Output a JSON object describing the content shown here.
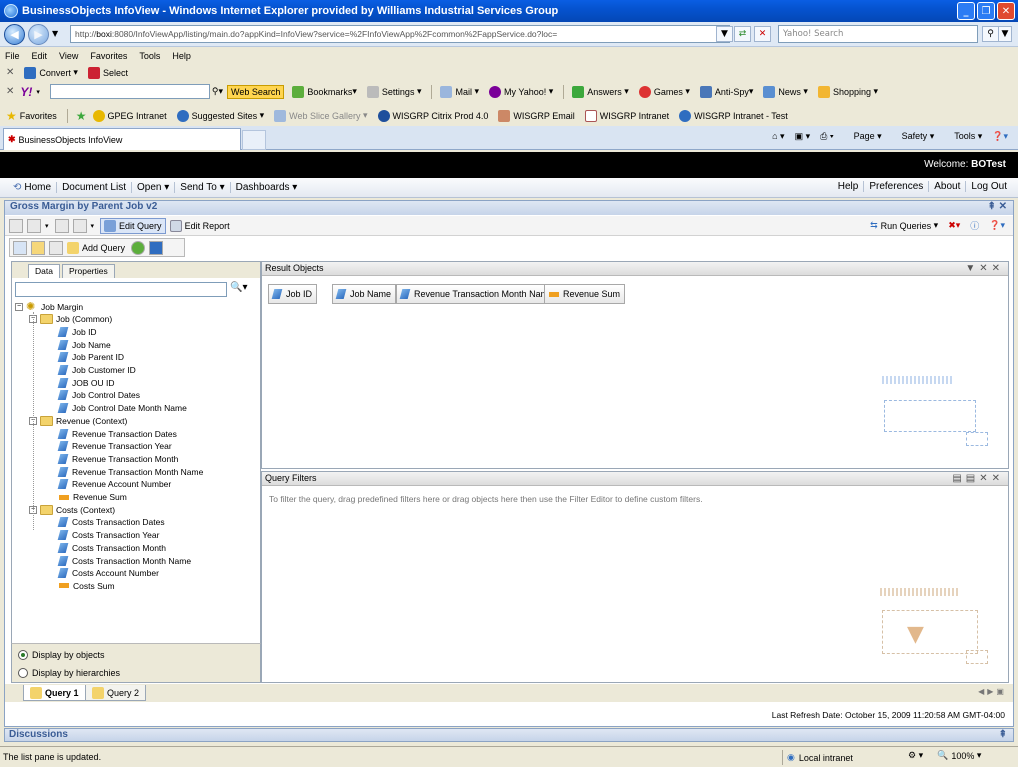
{
  "window": {
    "title": "BusinessObjects InfoView - Windows Internet Explorer provided by Williams Industrial Services Group",
    "buttons": [
      "_",
      "❐",
      "✕"
    ]
  },
  "address": {
    "url_prefix": "http://",
    "url_host": "boxi",
    "url_rest": ":8080/InfoViewApp/listing/main.do?appKind=InfoView?service=%2FInfoViewApp%2Fcommon%2FappService.do?loc=",
    "search_placeholder": "Yahoo! Search"
  },
  "menu": [
    "File",
    "Edit",
    "View",
    "Favorites",
    "Tools",
    "Help"
  ],
  "convert_bar": {
    "convert": "Convert",
    "select": "Select"
  },
  "yahoo_bar": {
    "logo": "Y!",
    "web_search": "Web Search",
    "items": [
      "Bookmarks",
      "Settings",
      "Mail",
      "My Yahoo!",
      "Answers",
      "Games",
      "Anti-Spy",
      "News",
      "Shopping"
    ]
  },
  "favorites_bar": {
    "favorites": "Favorites",
    "links": [
      "GPEG Intranet",
      "Suggested Sites",
      "Web Slice Gallery",
      "WISGRP Citrix Prod 4.0",
      "WISGRP Email",
      "WISGRP Intranet",
      "WISGRP Intranet - Test"
    ]
  },
  "ie_tab": {
    "title": "BusinessObjects InfoView"
  },
  "command_bar": [
    "Page",
    "Safety",
    "Tools"
  ],
  "app": {
    "welcome_label": "Welcome:",
    "user": "BOTest",
    "nav_left": [
      "Home",
      "Document List",
      "Open",
      "Send To",
      "Dashboards"
    ],
    "nav_right": [
      "Help",
      "Preferences",
      "About",
      "Log Out"
    ]
  },
  "document": {
    "title": "Gross Margin by Parent Job v2",
    "edit_query": "Edit Query",
    "edit_report": "Edit Report",
    "run_queries": "Run Queries",
    "add_query": "Add Query"
  },
  "left_panel": {
    "tabs": [
      "Data",
      "Properties"
    ],
    "root": "Job Margin",
    "folders": [
      {
        "name": "Job (Common)",
        "items": [
          {
            "label": "Job ID",
            "kind": "dimension"
          },
          {
            "label": "Job Name",
            "kind": "dimension"
          },
          {
            "label": "Job Parent ID",
            "kind": "dimension"
          },
          {
            "label": "Job Customer ID",
            "kind": "dimension"
          },
          {
            "label": "JOB OU ID",
            "kind": "dimension"
          },
          {
            "label": "Job Control Dates",
            "kind": "dimension"
          },
          {
            "label": "Job Control Date Month Name",
            "kind": "dimension"
          }
        ]
      },
      {
        "name": "Revenue (Context)",
        "items": [
          {
            "label": "Revenue Transaction Dates",
            "kind": "dimension"
          },
          {
            "label": "Revenue Transaction Year",
            "kind": "dimension"
          },
          {
            "label": "Revenue Transaction Month",
            "kind": "dimension"
          },
          {
            "label": "Revenue Transaction Month Name",
            "kind": "dimension"
          },
          {
            "label": "Revenue Account Number",
            "kind": "dimension"
          },
          {
            "label": "Revenue Sum",
            "kind": "measure"
          }
        ]
      },
      {
        "name": "Costs (Context)",
        "items": [
          {
            "label": "Costs Transaction Dates",
            "kind": "dimension"
          },
          {
            "label": "Costs Transaction Year",
            "kind": "dimension"
          },
          {
            "label": "Costs Transaction Month",
            "kind": "dimension"
          },
          {
            "label": "Costs Transaction Month Name",
            "kind": "dimension"
          },
          {
            "label": "Costs Account Number",
            "kind": "dimension"
          },
          {
            "label": "Costs Sum",
            "kind": "measure"
          }
        ]
      }
    ],
    "display_objects": "Display by objects",
    "display_hierarchies": "Display by hierarchies"
  },
  "result_objects": {
    "title": "Result Objects",
    "chips": [
      {
        "label": "Job ID",
        "kind": "dimension"
      },
      {
        "label": "Job Name",
        "kind": "dimension"
      },
      {
        "label": "Revenue Transaction Month Name",
        "kind": "dimension"
      },
      {
        "label": "Revenue Sum",
        "kind": "measure"
      }
    ]
  },
  "query_filters": {
    "title": "Query Filters",
    "hint": "To filter the query, drag predefined filters here or drag objects here then use the Filter Editor to define custom filters."
  },
  "query_tabs": [
    "Query 1",
    "Query 2"
  ],
  "last_refresh": "Last Refresh Date: October 15, 2009 11:20:58 AM GMT-04:00",
  "discussions": "Discussions",
  "status": {
    "message": "The list pane is updated.",
    "zone": "Local intranet",
    "zoom": "100%"
  }
}
